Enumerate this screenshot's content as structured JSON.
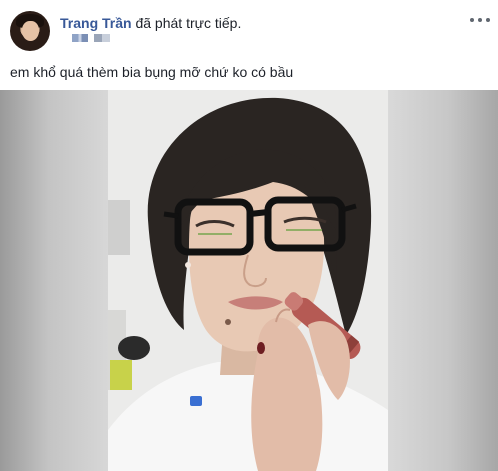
{
  "post": {
    "author": "Trang Trần",
    "action": " đã phát trực tiếp.",
    "caption": "em khổ quá thèm bia bụng mỡ chứ ko có bầu"
  },
  "icons": {
    "avatar": "profile-avatar",
    "more": "more-options-icon"
  },
  "colors": {
    "name": "#385898",
    "text": "#1d2129",
    "icon": "#606770"
  }
}
